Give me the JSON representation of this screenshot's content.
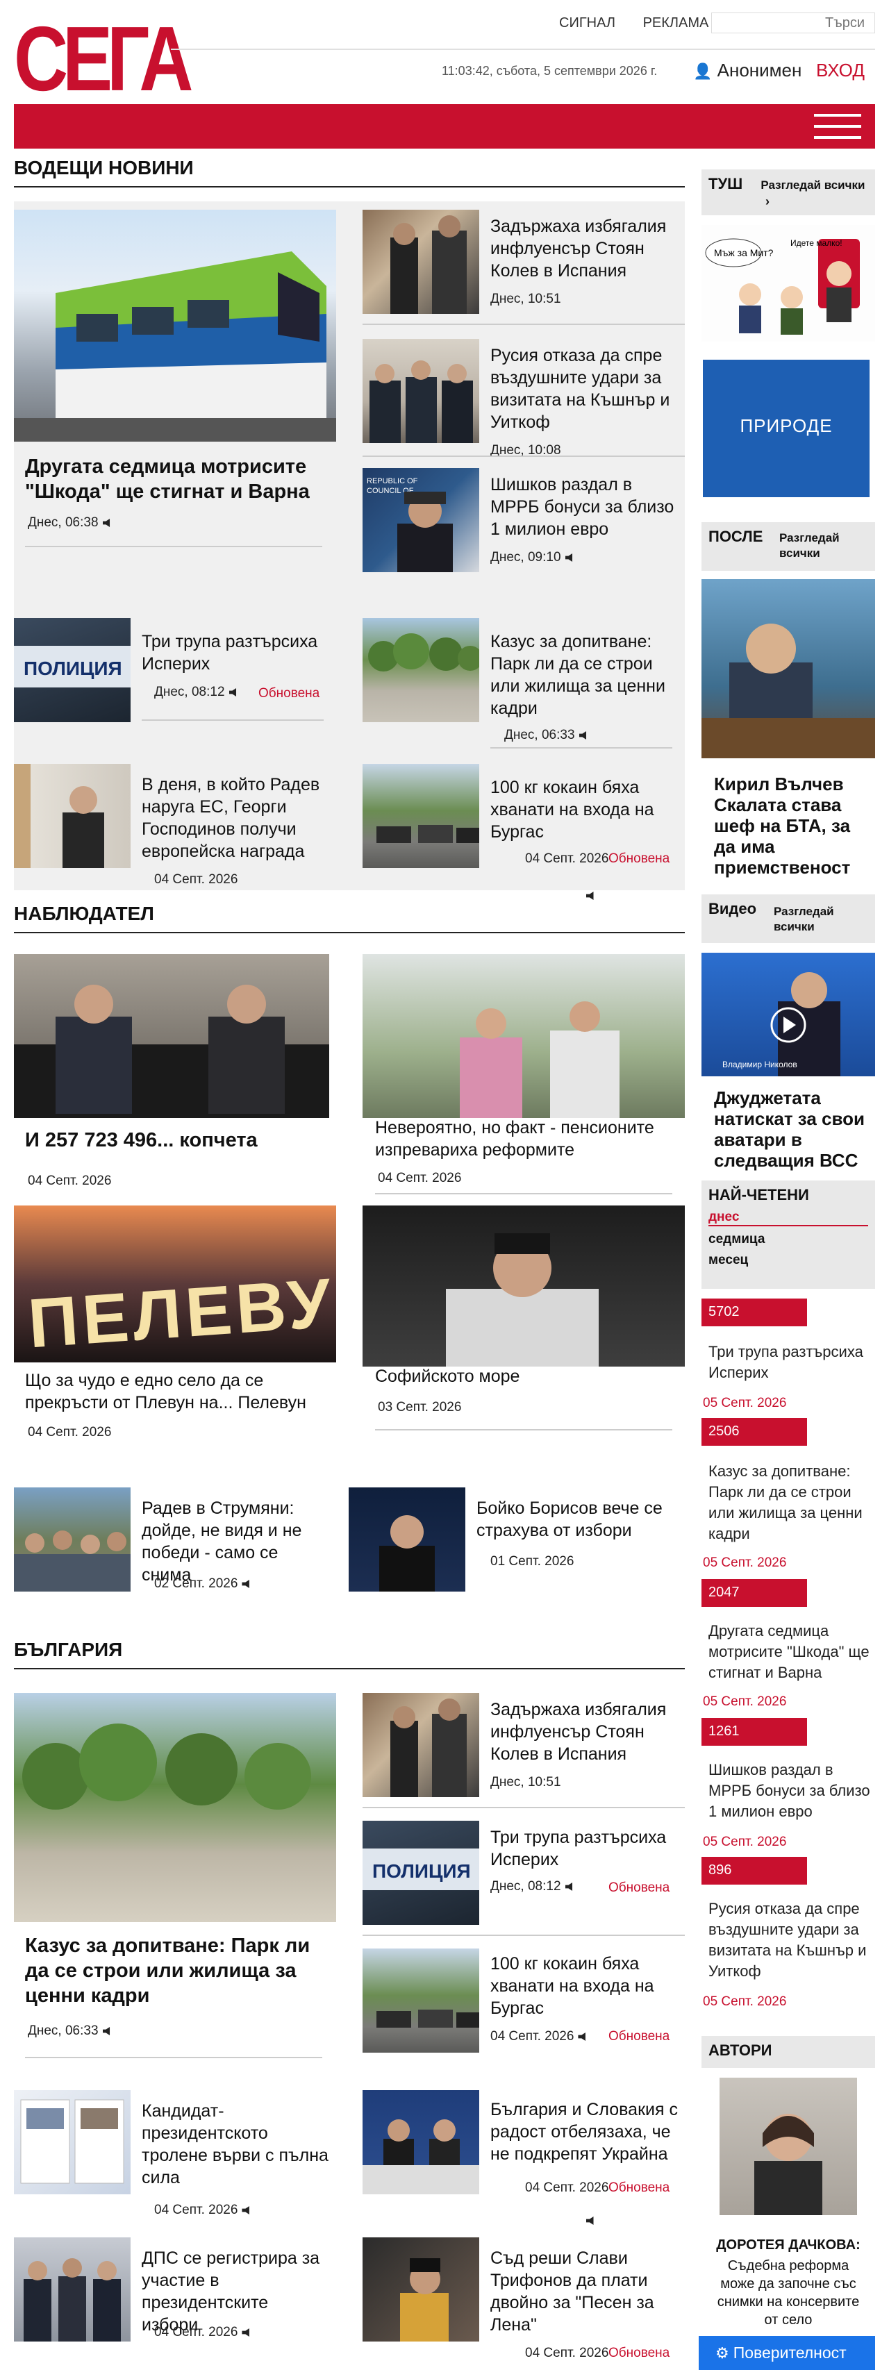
{
  "header": {
    "logo": "СЕГА",
    "links": [
      "СИГНАЛ",
      "РЕКЛАМА"
    ],
    "search_placeholder": "Търси",
    "datetime": "11:03:42, събота, 5 септември 2026 г.",
    "user": "Анонимен",
    "login": "ВХОД"
  },
  "sections": {
    "leading": "ВОДЕЩИ НОВИНИ",
    "observer": "НАБЛЮДАТЕЛ",
    "bulgaria": "БЪЛГАРИЯ"
  },
  "leading": {
    "main": {
      "title": "Другата седмица мотрисите \"Шкода\" ще стигнат и Варна",
      "meta": "Днес, 06:38"
    },
    "side": [
      {
        "title": "Задържаха избягалия инфлуенсър Стоян Колев в Испания",
        "meta": "Днес, 10:51"
      },
      {
        "title": "Русия отказа да спре въздушните удари за визитата на Къшнър и Уиткоф",
        "meta": "Днес, 10:08"
      },
      {
        "title": "Шишков раздал в МРРБ бонуси за близо 1 милион евро",
        "meta": "Днес, 09:10"
      }
    ],
    "grid": [
      {
        "title": "Три трупа разтърсиха Исперих",
        "meta": "Днес, 08:12",
        "updated": "Обновена"
      },
      {
        "title": "Казус за допитване: Парк ли да се строи или жилища за ценни кадри",
        "meta": "Днес, 06:33"
      },
      {
        "title": "В деня, в който Радев наруга ЕС, Георги Господинов получи европейска награда",
        "meta": "04 Септ. 2026"
      },
      {
        "title": "100 кг кокаин бяха хванати на входа на Бургас",
        "meta": "04 Септ. 2026",
        "updated": "Обновена"
      }
    ]
  },
  "observer": {
    "items": [
      {
        "title": "И 257 723 496... копчета",
        "meta": "04 Септ. 2026"
      },
      {
        "title": "Невероятно, но факт - пенсионите изпревариха реформите",
        "meta": "04 Септ. 2026"
      },
      {
        "title": "Що за чудо е едно село да се прекръсти от Плевун на... Пелевун",
        "meta": "04 Септ. 2026"
      },
      {
        "title": "Софийското море",
        "meta": "03 Септ. 2026"
      },
      {
        "title": "Радев в Струмяни: дойде, не видя и не победи - само се снима",
        "meta": "02 Септ. 2026"
      },
      {
        "title": "Бойко Борисов вече се страхува от избори",
        "meta": "01 Септ. 2026"
      }
    ],
    "sign_text": "ПЕЛЕВУН"
  },
  "bulgaria": {
    "main": {
      "title": "Казус за допитване: Парк ли да се строи или жилища за ценни кадри",
      "meta": "Днес, 06:33"
    },
    "side": [
      {
        "title": "Задържаха избягалия инфлуенсър Стоян Колев в Испания",
        "meta": "Днес, 10:51"
      },
      {
        "title": "Три трупа разтърсиха Исперих",
        "meta": "Днес, 08:12",
        "updated": "Обновена"
      },
      {
        "title": "100 кг кокаин бяха хванати на входа на Бургас",
        "meta": "04 Септ. 2026",
        "updated": "Обновена"
      }
    ],
    "grid": [
      {
        "title": "Кандидат-президентското тролене върви с пълна сила",
        "meta": "04 Септ. 2026"
      },
      {
        "title": "България и Словакия с радост отбелязаха, че не подкрепят Украйна",
        "meta": "04 Септ. 2026",
        "updated": "Обновена"
      },
      {
        "title": "ДПС се регистрира за участие в президентските избори",
        "meta": "04 Септ. 2026"
      },
      {
        "title": "Съд реши Слави Трифонов да плати двойно за \"Песен за Лена\"",
        "meta": "04 Септ. 2026",
        "updated": "Обновена"
      }
    ]
  },
  "police_sign": "ПОЛИЦИЯ",
  "sidebar": {
    "cartoon": {
      "head": "ТУШ",
      "link": "Разгледай всички",
      "bubble1": "Мъж за Мит?",
      "bubble2": "Идете малко!"
    },
    "ad_text": "ПРИРОДЕ",
    "after": {
      "head": "ПОСЛЕ",
      "link": "Разгледай всички",
      "title": "Кирил Вълчев Скалата става шеф на БТА, за да има приемственост"
    },
    "video": {
      "head": "Видео",
      "link": "Разгледай всички",
      "caption": "Владимир Николов",
      "title": "Джуджетата натискат за свои аватари в следващия ВСС"
    },
    "most_read": {
      "head": "НАЙ-ЧЕТЕНИ",
      "tabs": [
        "днес",
        "седмица",
        "месец"
      ],
      "items": [
        {
          "count": "5702",
          "title": "Три трупа разтърсиха Исперих",
          "date": "05 Септ. 2026"
        },
        {
          "count": "2506",
          "title": "Казус за допитване: Парк ли да се строи или жилища за ценни кадри",
          "date": "05 Септ. 2026"
        },
        {
          "count": "2047",
          "title": "Другата седмица мотрисите \"Шкода\" ще стигнат и Варна",
          "date": "05 Септ. 2026"
        },
        {
          "count": "1261",
          "title": "Шишков раздал в МРРБ бонуси за близо 1 милион евро",
          "date": "05 Септ. 2026"
        },
        {
          "count": "896",
          "title": "Русия отказа да спре въздушните удари за визитата на Къшнър и Уиткоф",
          "date": "05 Септ. 2026"
        }
      ]
    },
    "authors": {
      "head": "АВТОРИ",
      "name": "ДОРОТЕЯ ДАЧКОВА:",
      "text": "Съдебна реформа може да започне със снимки на консервите от село"
    }
  },
  "privacy_button": "Поверителност",
  "colors": {
    "brand": "#c8102e",
    "panel": "#f0f0f0",
    "privacy": "#1a73e8"
  }
}
